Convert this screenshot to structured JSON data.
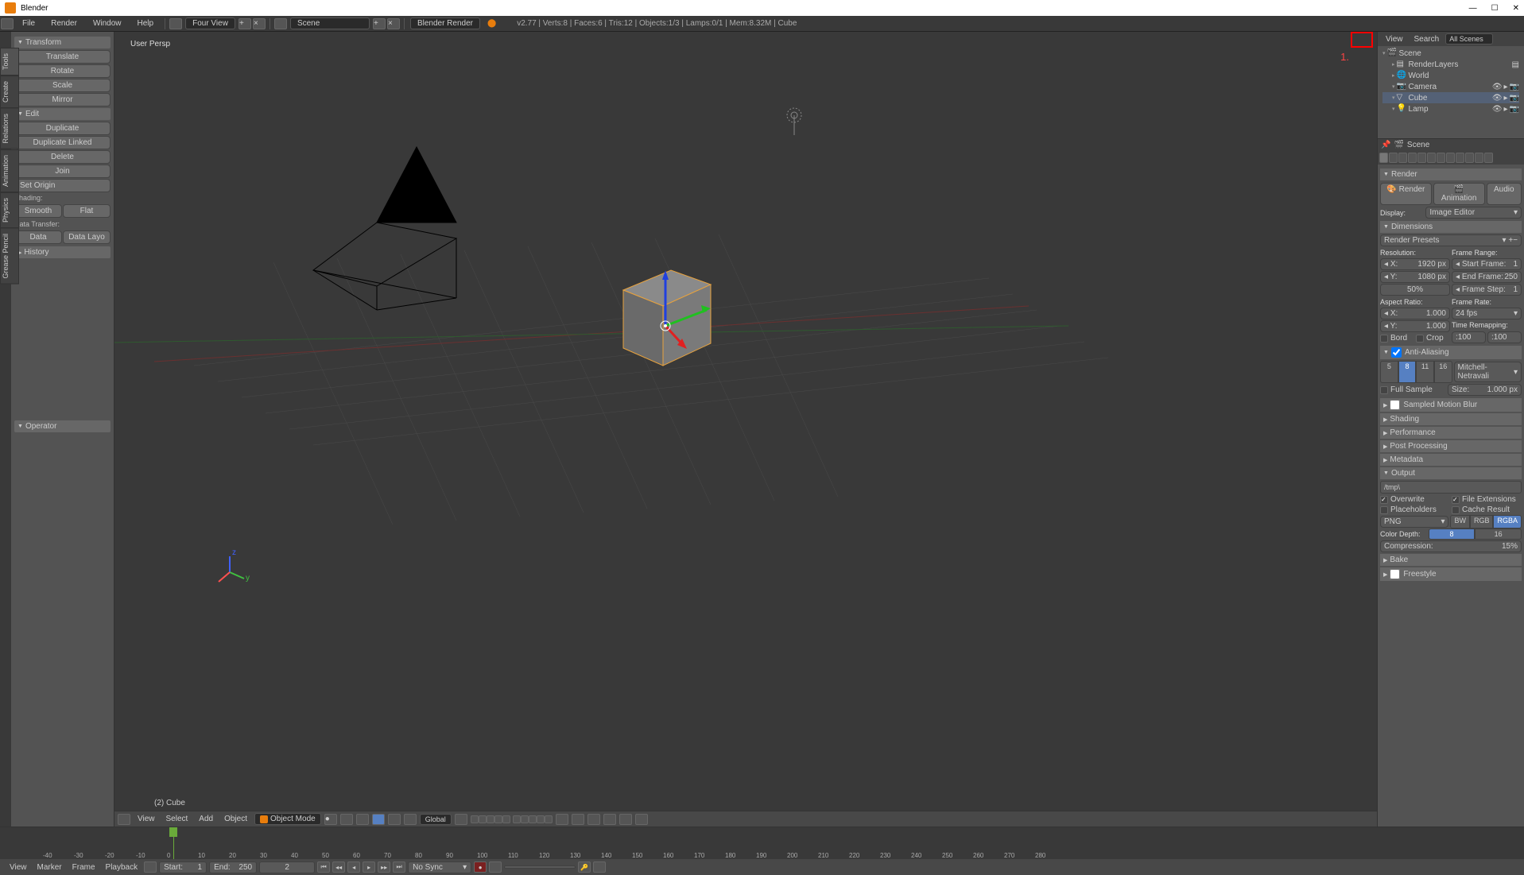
{
  "title": "Blender",
  "topmenu": {
    "items": [
      "File",
      "Render",
      "Window",
      "Help"
    ],
    "layout": "Four View",
    "scene": "Scene",
    "engine": "Blender Render"
  },
  "stats": "v2.77 | Verts:8 | Faces:6 | Tris:12 | Objects:1/3 | Lamps:0/1 | Mem:8.32M | Cube",
  "vtabs": [
    "Tools",
    "Create",
    "Relations",
    "Animation",
    "Physics",
    "Grease Pencil"
  ],
  "toolshelf": {
    "transform": {
      "title": "Transform",
      "btns": [
        "Translate",
        "Rotate",
        "Scale"
      ],
      "mirror": "Mirror"
    },
    "edit": {
      "title": "Edit",
      "btns": [
        "Duplicate",
        "Duplicate Linked",
        "Delete"
      ],
      "join": "Join",
      "origin": "Set Origin"
    },
    "shading": {
      "label": "Shading:",
      "smooth": "Smooth",
      "flat": "Flat"
    },
    "datatransfer": {
      "label": "Data Transfer:",
      "data": "Data",
      "datalayo": "Data Layo"
    },
    "history": "History",
    "operator": "Operator"
  },
  "viewport": {
    "persp": "User Persp",
    "objlabel": "(2) Cube"
  },
  "outliner": {
    "menu": [
      "View",
      "Search"
    ],
    "filter": "All Scenes",
    "tree": [
      {
        "name": "Scene",
        "depth": 0,
        "exp": true,
        "ico": "scene"
      },
      {
        "name": "RenderLayers",
        "depth": 1,
        "exp": false,
        "ico": "layers",
        "extra": true
      },
      {
        "name": "World",
        "depth": 1,
        "exp": false,
        "ico": "world"
      },
      {
        "name": "Camera",
        "depth": 1,
        "exp": true,
        "ico": "camera",
        "togs": true
      },
      {
        "name": "Cube",
        "depth": 1,
        "exp": true,
        "ico": "mesh",
        "togs": true,
        "sel": true
      },
      {
        "name": "Lamp",
        "depth": 1,
        "exp": true,
        "ico": "lamp",
        "togs": true
      }
    ]
  },
  "annotation": "1.",
  "props": {
    "scene": "Scene",
    "render": {
      "title": "Render",
      "renderBtn": "Render",
      "animBtn": "Animation",
      "audioBtn": "Audio",
      "displayLbl": "Display:",
      "displayVal": "Image Editor"
    },
    "dims": {
      "title": "Dimensions",
      "presets": "Render Presets",
      "resLbl": "Resolution:",
      "x": "X:",
      "xv": "1920 px",
      "y": "Y:",
      "yv": "1080 px",
      "pct": "50%",
      "frLbl": "Frame Range:",
      "start": "Start Frame:",
      "startv": "1",
      "end": "End Frame:",
      "endv": "250",
      "step": "Frame Step:",
      "stepv": "1",
      "arLbl": "Aspect Ratio:",
      "arx": "X:",
      "arxv": "1.000",
      "ary": "Y:",
      "aryv": "1.000",
      "rateLbl": "Frame Rate:",
      "rate": "24 fps",
      "remapLbl": "Time Remapping:",
      "r1": ":100",
      "r2": ":100",
      "bord": "Bord",
      "crop": "Crop"
    },
    "aa": {
      "title": "Anti-Aliasing",
      "samples": [
        "5",
        "8",
        "11",
        "16"
      ],
      "active": "8",
      "filter": "Mitchell-Netravali",
      "full": "Full Sample",
      "sizeLbl": "Size:",
      "sizeVal": "1.000 px"
    },
    "collapsed": [
      "Sampled Motion Blur",
      "Shading",
      "Performance",
      "Post Processing",
      "Metadata"
    ],
    "output": {
      "title": "Output",
      "path": "/tmp\\",
      "overwrite": "Overwrite",
      "ext": "File Extensions",
      "placeholders": "Placeholders",
      "cache": "Cache Result",
      "format": "PNG",
      "modes": [
        "BW",
        "RGB",
        "RGBA"
      ],
      "modeActive": "RGBA",
      "depthLbl": "Color Depth:",
      "depths": [
        "8",
        "16"
      ],
      "depthActive": "8",
      "compLbl": "Compression:",
      "compVal": "15%"
    },
    "bake": "Bake",
    "freestyle": "Freestyle"
  },
  "hdr3d": {
    "menu": [
      "View",
      "Select",
      "Add",
      "Object"
    ],
    "mode": "Object Mode",
    "orient": "Global"
  },
  "timeline": {
    "menu": [
      "View",
      "Marker",
      "Frame",
      "Playback"
    ],
    "start": "Start:",
    "startv": "1",
    "end": "End:",
    "endv": "250",
    "cur": "2",
    "sync": "No Sync",
    "ticks": [
      -40,
      -30,
      -20,
      -10,
      0,
      10,
      20,
      30,
      40,
      50,
      60,
      70,
      80,
      90,
      100,
      110,
      120,
      130,
      140,
      150,
      160,
      170,
      180,
      190,
      200,
      210,
      220,
      230,
      240,
      250,
      260,
      270,
      280
    ]
  }
}
